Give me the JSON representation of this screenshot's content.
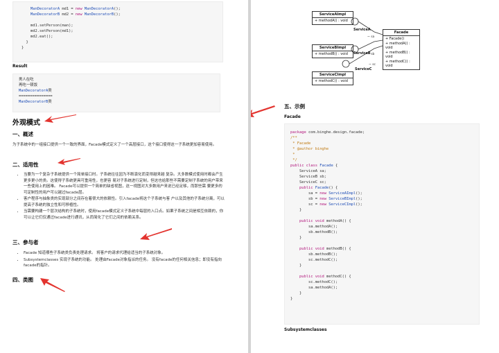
{
  "left": {
    "code_top": [
      "    ManDecoratorA md1 = new ManDecoratorA();",
      "    ManDecoratorB md2 = new ManDecoratorB();",
      "",
      "    md1.setPerson(man);",
      "    md2.setPerson(md1);",
      "    md2.eat();",
      "  }",
      "}"
    ],
    "result_label": "Result",
    "result_lines": [
      "男人在吃",
      "再吃一顿饭",
      "ManDecoratorA类",
      "===============",
      "ManDecoratorB类"
    ],
    "title": "外观模式",
    "sec1": "一、概述",
    "sec1_text": "为子系统中的一组接口提供一个一致的界面，Facade模式定义了一个高层接口，这个接口使得这一子系统更加容易使用。",
    "sec2": "二、适用性",
    "sec2_items": [
      "当要为一个复杂子系统提供一个简单接口时。子系统往往因为不断演化而变得越来越 复杂。大多数模式使用时都会产生更多更小的类。这使得子系统更具可重用性，也更容 易对子系统进行定制，但这也给那些不需要定制子系统的用户带来一些使用上的困难。 Facade可以提供一个简单的缺省视图，这一视图对大多数用户来说已经足够，而那些需 要更多的可定制性的用户可以越过facade层。",
      "客户程序与抽象类的实现部分之间存在着很大的依赖性。引入facade将这个子系统与客 户以及其他的子系统分离，可以提高子系统的独立性和可移植性。",
      "当需要构建一个层次结构的子系统时，使用facade模式定义子系统中每层的入口点。如果子系统之间是相互依赖的，你可以让它们仅通过facade进行通讯，从而简化了它们之间的依赖关系。"
    ],
    "sec3": "三、参与者",
    "sec3_items": [
      "Facade 知道哪些子系统类负责处理请求。 将客户的请求代理给适当的子系统对象。",
      "Subsystemclasses 实现子系统的功能。 处理由Facade对象指派的任务。 没有facade的任何相关信息；即没有指向facade的指针。"
    ],
    "sec4": "四、类图"
  },
  "right": {
    "uml": {
      "a_name": "ServiceAImpl",
      "a_method": "+ methodA() : void",
      "b_name": "ServiceBImpl",
      "b_method": "+ methodB() : void",
      "c_name": "ServiceCImpl",
      "c_method": "+ methodC() : void",
      "facade_name": "Facade",
      "facade_methods": [
        "+ Facade()",
        "+ methodA() : void",
        "+ methodB() : void",
        "+ methodC() : void"
      ],
      "label_a": "ServiceA",
      "label_b": "ServiceB",
      "label_c": "ServiceC",
      "role_sa": "~ sa",
      "role_sb": "~ sb",
      "role_sc": "~ sc"
    },
    "sec5": "五、示例",
    "facade_label": "Facade",
    "code": [
      "package com.binghe.design.facade;",
      "/**",
      " * Facade",
      " * @author binghe",
      " *",
      " */",
      "public class Facade {",
      "    ServiceA sa;",
      "    ServiceB sb;",
      "    ServiceC sc;",
      "    public Facade() {",
      "        sa = new ServiceAImpl();",
      "        sb = new ServiceBImpl();",
      "        sc = new ServiceCImpl();",
      "    }",
      "",
      "    public void methodA() {",
      "        sa.methodA();",
      "        sb.methodB();",
      "    }",
      "",
      "    public void methodB() {",
      "        sb.methodB();",
      "        sc.methodC();",
      "    }",
      "",
      "    public void methodC() {",
      "        sc.methodC();",
      "        sa.methodA();",
      "    }",
      "}"
    ],
    "subsystem_label": "Subsystemclasses"
  },
  "colors": {
    "arrow": "#e3342f",
    "keyword": "#b0127a",
    "comment": "#c07a12",
    "type": "#1c4bb5"
  }
}
